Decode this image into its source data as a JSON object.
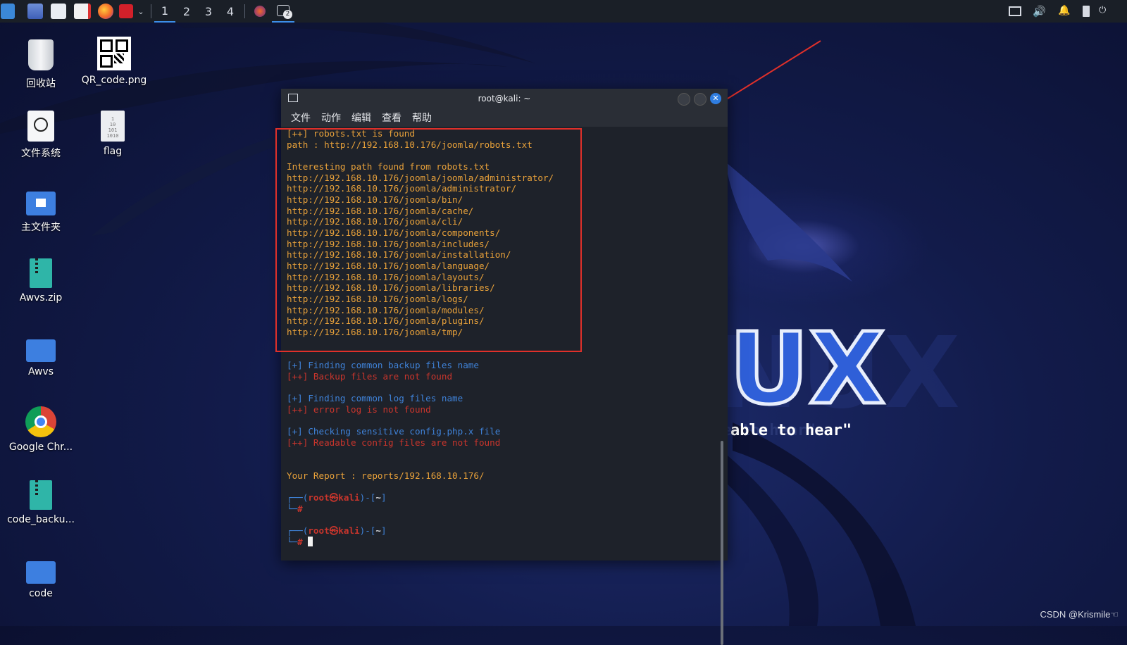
{
  "taskbar": {
    "workspaces": [
      "1",
      "2",
      "3",
      "4"
    ],
    "active_workspace": "1",
    "terminal_badge": "2"
  },
  "desktop": {
    "icons": [
      {
        "label": "回收站",
        "icon": "trash-icon"
      },
      {
        "label": "QR_code.png",
        "icon": "qr-code-icon"
      },
      {
        "label": "文件系统",
        "icon": "filesystem-icon"
      },
      {
        "label": "flag",
        "icon": "binary-file-icon"
      },
      {
        "label": "主文件夹",
        "icon": "home-folder-icon"
      },
      {
        "label": "Awvs.zip",
        "icon": "zip-icon"
      },
      {
        "label": "Awvs",
        "icon": "folder-icon"
      },
      {
        "label": "Google Chr...",
        "icon": "chrome-icon"
      },
      {
        "label": "code_backu...",
        "icon": "zip-link-icon"
      },
      {
        "label": "code",
        "icon": "folder-icon"
      }
    ]
  },
  "wallpaper": {
    "brand_text": "KALI LINUX",
    "tagline": "\"the quieter you become, the more you are able to hear\""
  },
  "terminal": {
    "title": "root@kali: ~",
    "menu": [
      "文件",
      "动作",
      "编辑",
      "查看",
      "帮助"
    ],
    "lines": [
      {
        "cls": "o",
        "text": "[++] robots.txt is found"
      },
      {
        "cls": "o",
        "text": "path : http://192.168.10.176/joomla/robots.txt"
      },
      {
        "cls": "o",
        "text": ""
      },
      {
        "cls": "o",
        "text": "Interesting path found from robots.txt"
      },
      {
        "cls": "o",
        "text": "http://192.168.10.176/joomla/joomla/administrator/"
      },
      {
        "cls": "o",
        "text": "http://192.168.10.176/joomla/administrator/"
      },
      {
        "cls": "o",
        "text": "http://192.168.10.176/joomla/bin/"
      },
      {
        "cls": "o",
        "text": "http://192.168.10.176/joomla/cache/"
      },
      {
        "cls": "o",
        "text": "http://192.168.10.176/joomla/cli/"
      },
      {
        "cls": "o",
        "text": "http://192.168.10.176/joomla/components/"
      },
      {
        "cls": "o",
        "text": "http://192.168.10.176/joomla/includes/"
      },
      {
        "cls": "o",
        "text": "http://192.168.10.176/joomla/installation/"
      },
      {
        "cls": "o",
        "text": "http://192.168.10.176/joomla/language/"
      },
      {
        "cls": "o",
        "text": "http://192.168.10.176/joomla/layouts/"
      },
      {
        "cls": "o",
        "text": "http://192.168.10.176/joomla/libraries/"
      },
      {
        "cls": "o",
        "text": "http://192.168.10.176/joomla/logs/"
      },
      {
        "cls": "o",
        "text": "http://192.168.10.176/joomla/modules/"
      },
      {
        "cls": "o",
        "text": "http://192.168.10.176/joomla/plugins/"
      },
      {
        "cls": "o",
        "text": "http://192.168.10.176/joomla/tmp/"
      },
      {
        "cls": "o",
        "text": ""
      },
      {
        "cls": "o",
        "text": ""
      },
      {
        "cls": "b",
        "text": "[+] Finding common backup files name"
      },
      {
        "cls": "r",
        "text": "[++] Backup files are not found"
      },
      {
        "cls": "o",
        "text": ""
      },
      {
        "cls": "b",
        "text": "[+] Finding common log files name"
      },
      {
        "cls": "r",
        "text": "[++] error log is not found"
      },
      {
        "cls": "o",
        "text": ""
      },
      {
        "cls": "b",
        "text": "[+] Checking sensitive config.php.x file"
      },
      {
        "cls": "r",
        "text": "[++] Readable config files are not found"
      },
      {
        "cls": "o",
        "text": ""
      },
      {
        "cls": "o",
        "text": ""
      },
      {
        "cls": "o",
        "text": "Your Report : reports/192.168.10.176/"
      },
      {
        "cls": "o",
        "text": ""
      }
    ],
    "prompt": {
      "user": "root",
      "at": "㉿",
      "host": "kali",
      "dir": "~",
      "symbol": "#"
    }
  },
  "watermark": "CSDN @Krismile☜",
  "colors": {
    "orange": "#e8a13a",
    "blue": "#3f82d8",
    "red": "#c9352c",
    "highlight_box": "#e0302a"
  }
}
